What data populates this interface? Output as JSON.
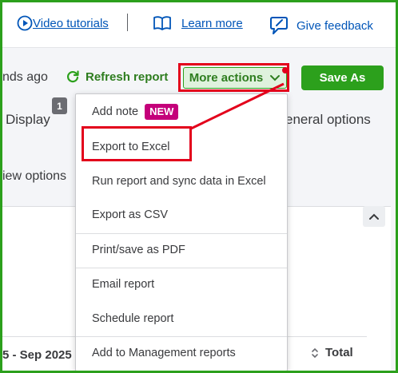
{
  "top_bar": {
    "video_tutorials": "Video tutorials",
    "learn_more": "Learn more",
    "give_feedback": "Give feedback"
  },
  "toolbar": {
    "updated_text": "nds ago",
    "refresh_label": "Refresh report",
    "more_actions_label": "More actions",
    "save_as_label": "Save As",
    "display_badge": "1",
    "tab_display": "Display",
    "tab_general": "eneral options",
    "view_options": "iew options"
  },
  "dropdown": {
    "items": [
      {
        "label": "Add note",
        "badge": "NEW"
      },
      {
        "label": "Export to Excel"
      },
      {
        "label": "Run report and sync data in Excel"
      },
      {
        "label": "Export as CSV"
      },
      {
        "label": "Print/save as PDF"
      },
      {
        "label": "Email report"
      },
      {
        "label": "Schedule report"
      },
      {
        "label": "Add to Management reports"
      }
    ]
  },
  "report": {
    "date_column": "5 - Sep 2025",
    "total_column": "Total"
  },
  "colors": {
    "accent_green": "#2ca01c",
    "link_blue": "#0055b8",
    "highlight_red": "#e3001b",
    "new_badge": "#c4007a"
  },
  "icons": [
    "play-circle-icon",
    "book-icon",
    "feedback-icon",
    "refresh-icon",
    "chevron-down-icon",
    "chevron-up-icon",
    "sort-icon"
  ]
}
